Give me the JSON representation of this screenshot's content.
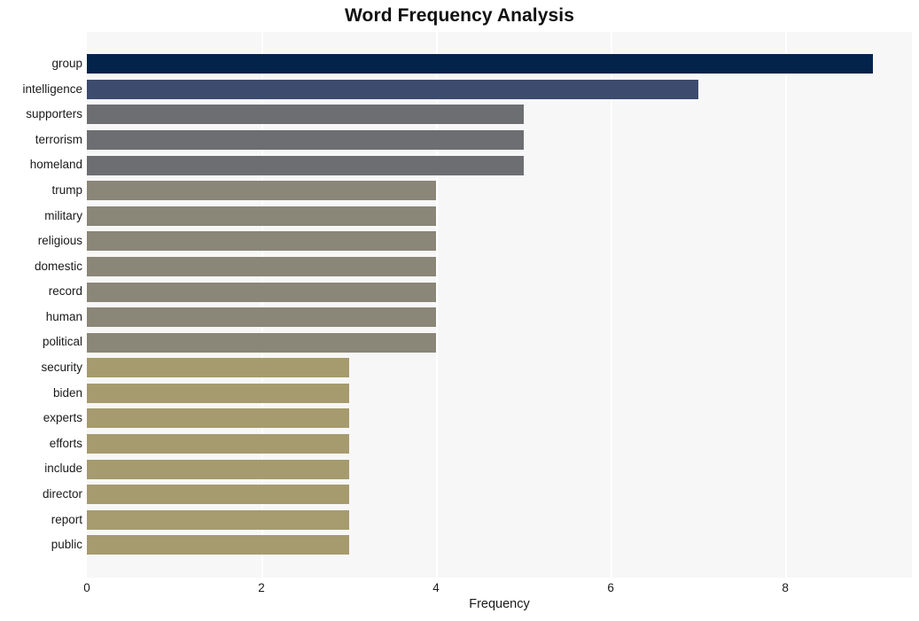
{
  "chart_data": {
    "type": "bar",
    "orientation": "horizontal",
    "title": "Word Frequency Analysis",
    "xlabel": "Frequency",
    "ylabel": "",
    "xlim": [
      0,
      9.45
    ],
    "ylim": [
      0,
      20
    ],
    "grid": true,
    "grid_axis": "x",
    "legend": false,
    "legend_position": "none",
    "xticks": [
      0,
      2,
      4,
      6,
      8
    ],
    "xtick_labels": [
      "0",
      "2",
      "4",
      "6",
      "8"
    ],
    "categories": [
      "group",
      "intelligence",
      "supporters",
      "terrorism",
      "homeland",
      "trump",
      "military",
      "religious",
      "domestic",
      "record",
      "human",
      "political",
      "security",
      "biden",
      "experts",
      "efforts",
      "include",
      "director",
      "report",
      "public"
    ],
    "values": [
      9,
      7,
      5,
      5,
      5,
      4,
      4,
      4,
      4,
      4,
      4,
      4,
      3,
      3,
      3,
      3,
      3,
      3,
      3,
      3
    ],
    "bar_colors": [
      "#04234b",
      "#3c4b६e",
      "#6c6e71",
      "#6c6e71",
      "#6c6e71",
      "#8a8678",
      "#8a8678",
      "#8a8678",
      "#8a8678",
      "#8a8678",
      "#8a8678",
      "#8a8678",
      "#a69b6e",
      "#a69b6e",
      "#a69b6e",
      "#a69b6e",
      "#a69b6e",
      "#a69b6e",
      "#a69b6e",
      "#a69b6e"
    ],
    "plot_background": "#f7f7f7",
    "figure_background": "#ffffff",
    "gridline_color": "#ffffff"
  },
  "colors": {
    "bar_rank1": "#04234b",
    "bar_rank2": "#3c4b6e",
    "bar_rank3": "#6c6e71",
    "bar_rank4": "#8a8678",
    "bar_rank5": "#a69b6e",
    "plot_bg": "#f7f7f7",
    "page_bg": "#ffffff",
    "grid": "#ffffff",
    "text": "#1a1a1a",
    "title": "#111111"
  }
}
